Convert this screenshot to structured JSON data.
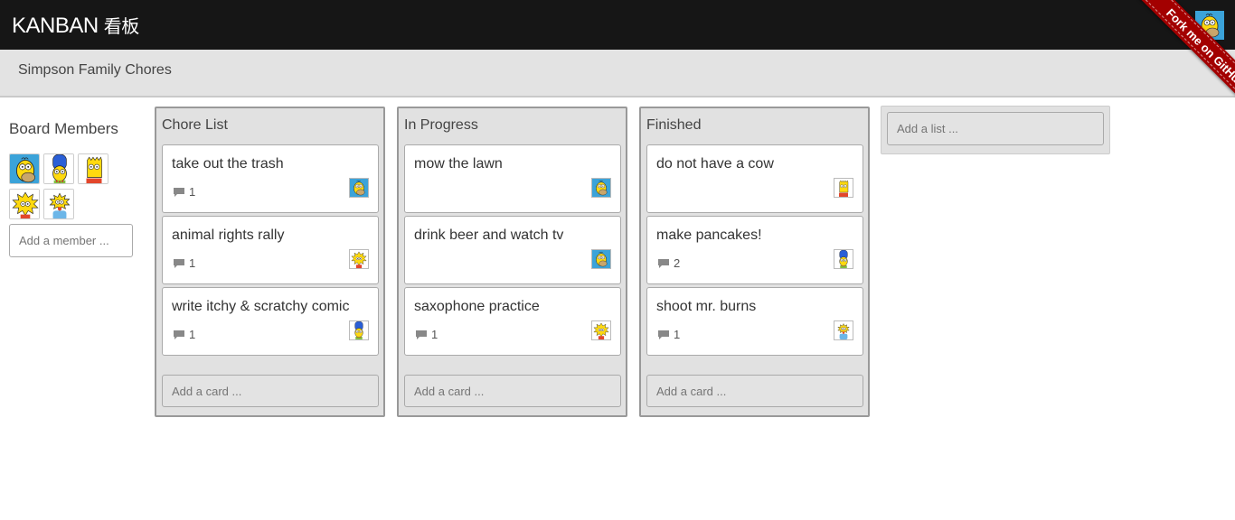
{
  "app": {
    "brand": "KANBAN",
    "brand_cjk": "看板"
  },
  "ribbon": {
    "label": "Fork me on GitHub"
  },
  "board": {
    "title": "Simpson Family Chores"
  },
  "members": {
    "title": "Board Members",
    "avatars": [
      "homer",
      "marge",
      "bart",
      "lisa",
      "maggie"
    ],
    "add_placeholder": "Add a member ..."
  },
  "lists": [
    {
      "title": "Chore List",
      "add_card_placeholder": "Add a card ...",
      "cards": [
        {
          "title": "take out the trash",
          "comments": "1",
          "assignee": "homer"
        },
        {
          "title": "animal rights rally",
          "comments": "1",
          "assignee": "lisa"
        },
        {
          "title": "write itchy & scratchy comic",
          "comments": "1",
          "assignee": "marge"
        }
      ]
    },
    {
      "title": "In Progress",
      "add_card_placeholder": "Add a card ...",
      "cards": [
        {
          "title": "mow the lawn",
          "comments": "",
          "assignee": "homer"
        },
        {
          "title": "drink beer and watch tv",
          "comments": "",
          "assignee": "homer"
        },
        {
          "title": "saxophone practice",
          "comments": "1",
          "assignee": "lisa"
        }
      ]
    },
    {
      "title": "Finished",
      "add_card_placeholder": "Add a card ...",
      "cards": [
        {
          "title": "do not have a cow",
          "comments": "",
          "assignee": "bart"
        },
        {
          "title": "make pancakes!",
          "comments": "2",
          "assignee": "marge"
        },
        {
          "title": "shoot mr. burns",
          "comments": "1",
          "assignee": "maggie"
        }
      ]
    }
  ],
  "add_list_placeholder": "Add a list ..."
}
